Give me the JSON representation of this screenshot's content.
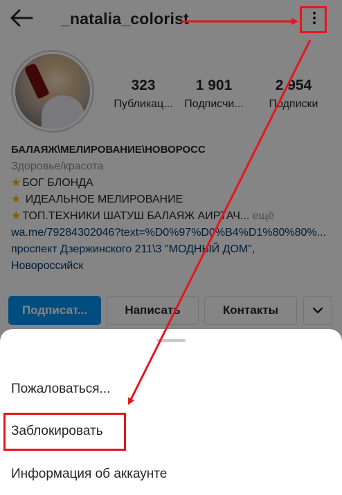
{
  "header": {
    "username": "_natalia_colorist"
  },
  "stats": [
    {
      "value": "323",
      "label": "Публикац..."
    },
    {
      "value": "1 901",
      "label": "Подписчи..."
    },
    {
      "value": "2 954",
      "label": "Подписки"
    }
  ],
  "bio": {
    "name": "БАЛАЯЖ\\МЕЛИРОВАНИЕ\\НОВОРОСС",
    "category": "Здоровье/красота",
    "line1": "БОГ БЛОНДА",
    "line2": "ИДЕАЛЬНОЕ МЕЛИРОВАНИЕ",
    "line3": "ТОП.ТЕХНИКИ ШАТУШ БАЛАЯЖ АИРТАЧ...",
    "more": "ещё",
    "link": "wa.me/79284302046?text=%D0%97%D0%B4%D1%80%80%...",
    "address1": "проспект Дзержинского 211\\3 \"МОДНЫЙ ДОМ\",",
    "address2": "Новороссийск",
    "star_icon": "star-emoji"
  },
  "buttons": {
    "follow": "Подписат...",
    "message": "Написать",
    "contacts": "Контакты"
  },
  "sheet": {
    "items": [
      "Пожаловаться...",
      "Заблокировать",
      "Информация об аккаунте"
    ]
  },
  "colors": {
    "accent": "#0095f6",
    "annotation": "#e8141c"
  }
}
